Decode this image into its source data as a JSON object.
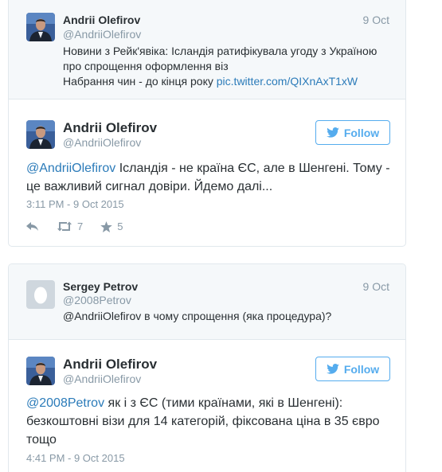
{
  "conversation": [
    {
      "quoted": {
        "name": "Andrii Olefirov",
        "handle": "@AndriiOlefirov",
        "date": "9 Oct",
        "line1": "Новини з Рейк'явіка: Ісландія ратифікувала угоду з Україною",
        "line2": "про спрощення оформлення віз",
        "line3_text": "Набрання чин - до кінця року ",
        "line3_link": "pic.twitter.com/QIXnAxT1xW"
      },
      "reply": {
        "name": "Andrii Olefirov",
        "handle": "@AndriiOlefirov",
        "follow_label": "Follow",
        "mention": "@AndriiOlefirov",
        "text_line1": " Ісландія - не країна ЄС, але в Шенгені. Тому -",
        "text_line2": "це важливий сигнал довіри. Йдемо далі...",
        "timestamp": "3:11 PM - 9 Oct 2015",
        "retweets": "7",
        "likes": "5"
      }
    },
    {
      "quoted": {
        "name": "Sergey Petrov",
        "handle": "@2008Petrov",
        "date": "9 Oct",
        "text": "@AndriiOlefirov в чому спрощення (яка процедура)?"
      },
      "reply": {
        "name": "Andrii Olefirov",
        "handle": "@AndriiOlefirov",
        "follow_label": "Follow",
        "mention": "@2008Petrov",
        "text_line1": " як і з ЄС (тими країнами, які в Шенгені):",
        "text_line2": "безкоштовні візи для 14 категорій, фіксована ціна в 35 євро",
        "text_line3": "тощо",
        "timestamp": "4:41 PM - 9 Oct 2015"
      }
    }
  ],
  "colors": {
    "link": "#2b7bb9",
    "follow": "#55acee",
    "muted": "#8899a6",
    "text": "#292f33",
    "quoted_bg": "#f5f8fa",
    "border": "#e1e8ed"
  },
  "icons": [
    "reply-icon",
    "retweet-icon",
    "like-star-icon",
    "twitter-bird-icon",
    "avatar",
    "default-egg-avatar"
  ]
}
